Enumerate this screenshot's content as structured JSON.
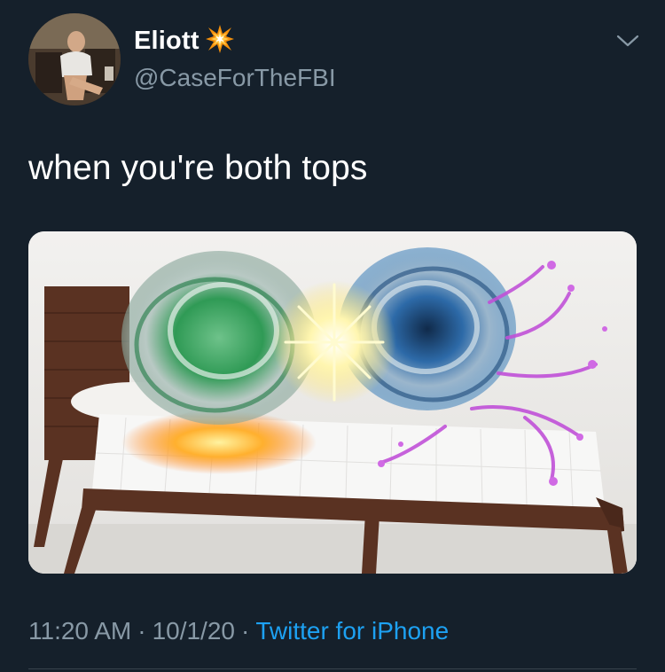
{
  "tweet": {
    "display_name": "Eliott",
    "name_emoji": "collision-icon",
    "handle": "@CaseForTheFBI",
    "text": "when you're both tops",
    "time": "11:20 AM",
    "date": "10/1/20",
    "source": "Twitter for iPhone",
    "separator": "·"
  },
  "media": {
    "description_icon": "photo",
    "image": "beyblades-on-bed"
  },
  "colors": {
    "background": "#15202b",
    "secondary_text": "#8899a6",
    "link": "#1da1f2",
    "divider": "#38444d"
  }
}
